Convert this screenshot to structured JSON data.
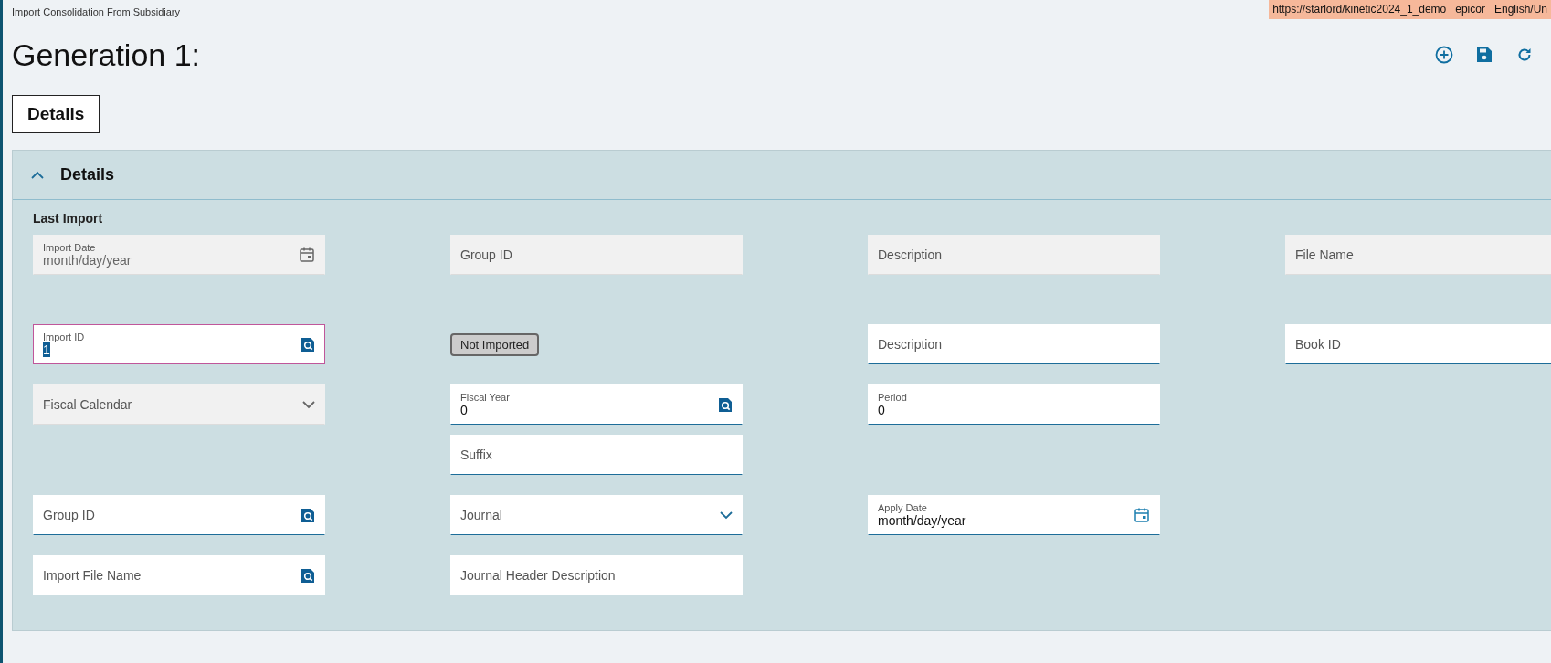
{
  "window": {
    "title": "Import Consolidation From Subsidiary",
    "environment": "https://starlord/kinetic2024_1_demo   epicor   English/Un"
  },
  "heading": "Generation 1:",
  "toolbar": [
    {
      "kind": "add"
    },
    {
      "kind": "save"
    },
    {
      "kind": "refresh"
    }
  ],
  "tabs": [
    {
      "label": "Details",
      "selected": true
    }
  ],
  "panel": {
    "title": "Details",
    "expanded": true,
    "section": "Last Import",
    "rows": [
      [
        {
          "kind": "date",
          "label": "Import Date",
          "value": "month/day/year",
          "disabled": true,
          "focused": false
        },
        {
          "kind": "text",
          "label": "Group ID",
          "disabled": true,
          "focused": false
        },
        {
          "kind": "text",
          "label": "Description",
          "disabled": true,
          "focused": false
        },
        {
          "kind": "text",
          "label": "File Name",
          "disabled": true,
          "focused": false
        }
      ],
      [
        {
          "kind": "lookup",
          "label": "Import ID",
          "value": "1",
          "disabled": false,
          "focused": true
        },
        {
          "kind": "status",
          "label": "Not Imported"
        },
        {
          "kind": "text",
          "label": "Description",
          "disabled": false,
          "focused": false
        },
        {
          "kind": "text",
          "label": "Book ID",
          "disabled": false,
          "focused": false
        }
      ],
      [
        {
          "kind": "select",
          "label": "Fiscal Calendar",
          "disabled": true,
          "focused": false
        },
        {
          "kind": "lookup",
          "label": "Fiscal Year",
          "value": "0",
          "disabled": false,
          "focused": false
        },
        {
          "kind": "text",
          "label": "Period",
          "value": "0",
          "disabled": false,
          "focused": false
        },
        null
      ],
      [
        null,
        {
          "kind": "text",
          "label": "Suffix",
          "disabled": false,
          "focused": false
        },
        null,
        null
      ],
      [
        {
          "kind": "lookup",
          "label": "Group ID",
          "disabled": false,
          "focused": false
        },
        {
          "kind": "select",
          "label": "Journal",
          "disabled": false,
          "focused": false
        },
        {
          "kind": "date",
          "label": "Apply Date",
          "value": "month/day/year",
          "disabled": false,
          "focused": false
        },
        null
      ],
      [
        {
          "kind": "lookup",
          "label": "Import File Name",
          "disabled": false,
          "focused": false
        },
        {
          "kind": "text",
          "label": "Journal Header Description",
          "disabled": false,
          "focused": false
        },
        null,
        null
      ]
    ]
  }
}
